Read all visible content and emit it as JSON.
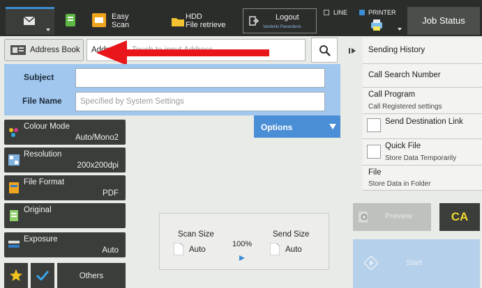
{
  "topbar": {
    "easy_scan_line1": "Easy",
    "easy_scan_line2": "Scan",
    "hdd_line1": "HDD",
    "hdd_line2": "File retrieve",
    "logout_label": "Logout",
    "logout_user": "Vardenis Pavardenis",
    "line_label": "LINE",
    "printer_label": "PRINTER",
    "job_status": "Job Status"
  },
  "address": {
    "book_label": "Address Book",
    "field_label": "Address",
    "placeholder": "Touch to input Address"
  },
  "form": {
    "subject_label": "Subject",
    "subject_value": "",
    "filename_label": "File Name",
    "filename_placeholder": "Specified by System Settings",
    "options_label": "Options"
  },
  "settings": [
    {
      "name": "Colour Mode",
      "value": "Auto/Mono2"
    },
    {
      "name": "Resolution",
      "value": "200x200dpi"
    },
    {
      "name": "File Format",
      "value": "PDF"
    },
    {
      "name": "Original",
      "value": ""
    },
    {
      "name": "Exposure",
      "value": "Auto"
    }
  ],
  "bottom_left": {
    "others_label": "Others"
  },
  "right_panel": [
    {
      "title": "Sending History",
      "sub": ""
    },
    {
      "title": "Call Search Number",
      "sub": ""
    },
    {
      "title": "Call Program",
      "sub": "Call Registered settings"
    },
    {
      "title": "Send Destination Link",
      "sub": ""
    },
    {
      "title": "Quick File",
      "sub": "Store Data Temporarily"
    },
    {
      "title": "File",
      "sub": "Store Data in Folder"
    }
  ],
  "scan": {
    "scan_size_label": "Scan Size",
    "scan_size_value": "Auto",
    "ratio": "100%",
    "send_size_label": "Send Size",
    "send_size_value": "Auto"
  },
  "actions": {
    "preview_label": "Preview",
    "ca_label": "CA",
    "start_label": "Start"
  },
  "colors": {
    "accent_blue": "#4a8ed6",
    "panel_blue": "#a2c7ee",
    "arrow_red": "#e8161b",
    "ca_yellow": "#f0d92c"
  }
}
